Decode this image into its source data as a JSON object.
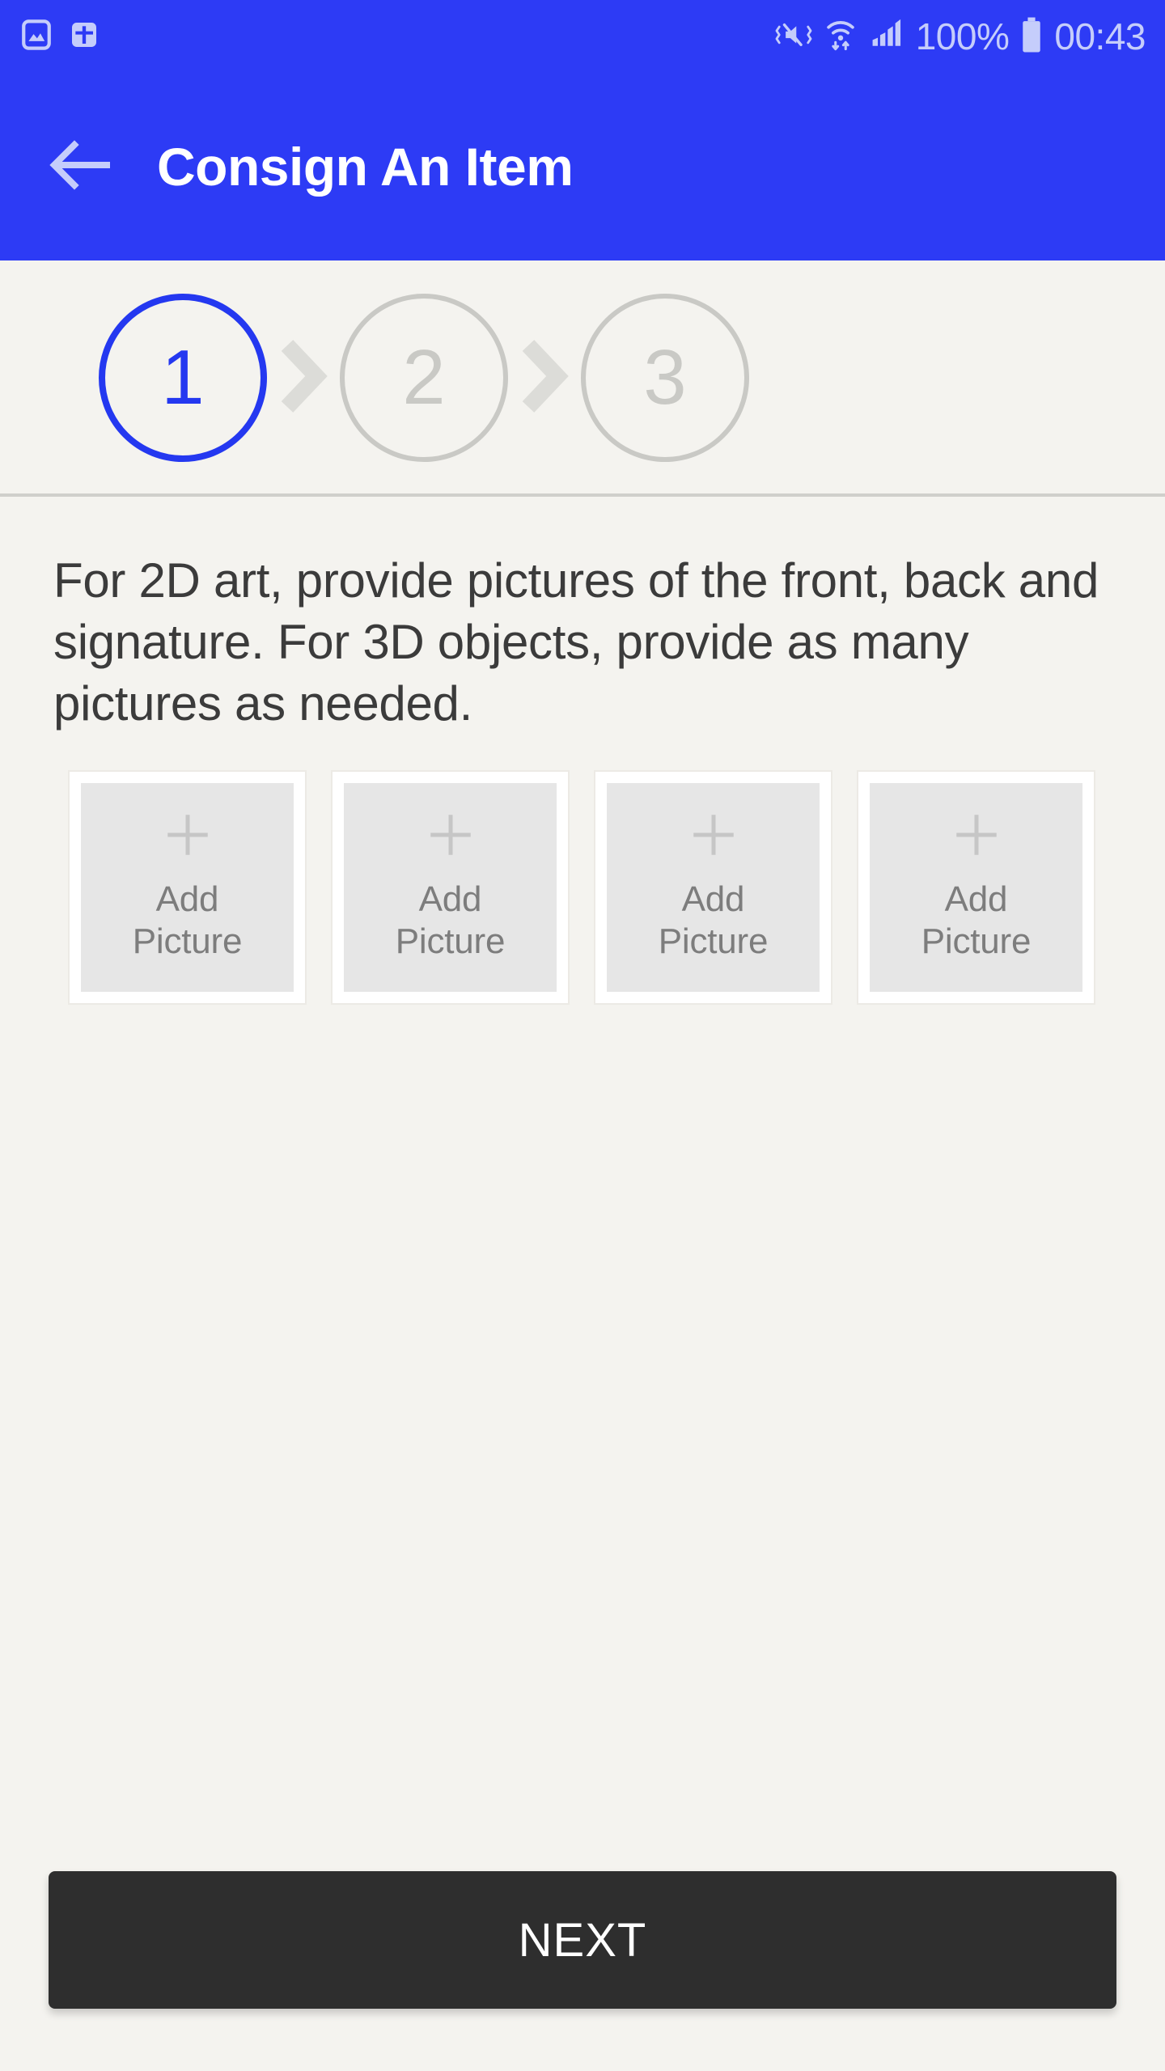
{
  "statusbar": {
    "icons_left": [
      "image-icon",
      "health-plus-icon"
    ],
    "icons_right": [
      "vibrate-mute-icon",
      "wifi-icon",
      "signal-icon",
      "battery-icon"
    ],
    "battery_percent": "100%",
    "clock": "00:43",
    "background_color": "#2d3bf5",
    "icon_color": "#c5cdfb"
  },
  "appbar": {
    "back_icon": "arrow-left-icon",
    "title": "Consign An Item",
    "background_color": "#2d3bf5",
    "title_color": "#ffffff"
  },
  "stepper": {
    "separator_icon": "chevron-right-icon",
    "active_color": "#2438f0",
    "inactive_color": "#c9c9c5",
    "steps": [
      {
        "number": "1",
        "state": "active"
      },
      {
        "number": "2",
        "state": "inactive"
      },
      {
        "number": "3",
        "state": "inactive"
      }
    ]
  },
  "content": {
    "description": "For 2D art, provide pictures of the front, back and signature. For 3D objects, provide as many pictures as needed.",
    "tiles": [
      {
        "icon": "plus-icon",
        "label": "Add\nPicture"
      },
      {
        "icon": "plus-icon",
        "label": "Add\nPicture"
      },
      {
        "icon": "plus-icon",
        "label": "Add\nPicture"
      },
      {
        "icon": "plus-icon",
        "label": "Add\nPicture"
      }
    ]
  },
  "footer": {
    "next_label": "NEXT",
    "button_color": "#2e2e2e",
    "label_color": "#ffffff"
  },
  "page": {
    "background_color": "#f4f3ef",
    "divider_color": "#cfcfcb"
  }
}
